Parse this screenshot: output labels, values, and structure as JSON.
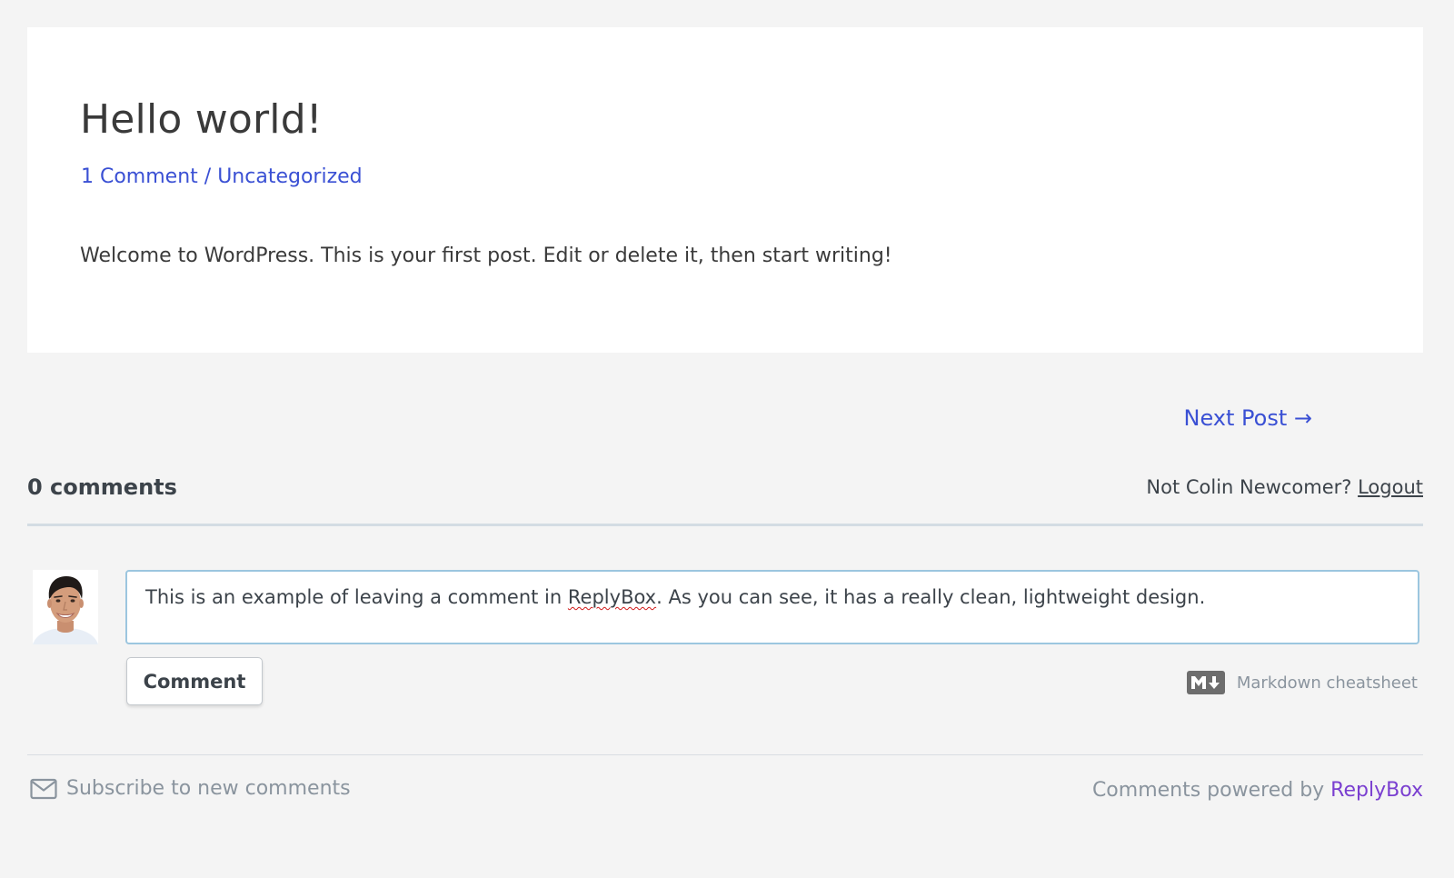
{
  "post": {
    "title": "Hello world!",
    "meta": {
      "comments_link": "1 Comment",
      "separator": "/",
      "category_link": "Uncategorized"
    },
    "content": "Welcome to WordPress. This is your first post. Edit or delete it, then start writing!"
  },
  "navigation": {
    "next_post": "Next Post →"
  },
  "comments": {
    "count_label": "0 comments",
    "auth_prompt": "Not Colin Newcomer?",
    "logout_label": "Logout",
    "composer": {
      "text_before": "This is an example of leaving a comment in",
      "misspelled_word": "ReplyBox",
      "text_after": ". As you can see, it has a really clean, lightweight design."
    },
    "submit_label": "Comment",
    "markdown_label": "Markdown cheatsheet",
    "markdown_icon": "markdown-icon"
  },
  "footer": {
    "subscribe_label": "Subscribe to new comments",
    "subscribe_icon": "envelope-icon",
    "powered_prefix": "Comments powered by",
    "powered_link": "ReplyBox"
  },
  "colors": {
    "background": "#f4f4f4",
    "card": "#ffffff",
    "link_blue": "#3a50d4",
    "text_dark": "#3c434a",
    "muted": "#8a949e",
    "brand_purple": "#7a3fd0",
    "input_border": "#9cc6df",
    "spellcheck_red": "#d11a1a"
  }
}
